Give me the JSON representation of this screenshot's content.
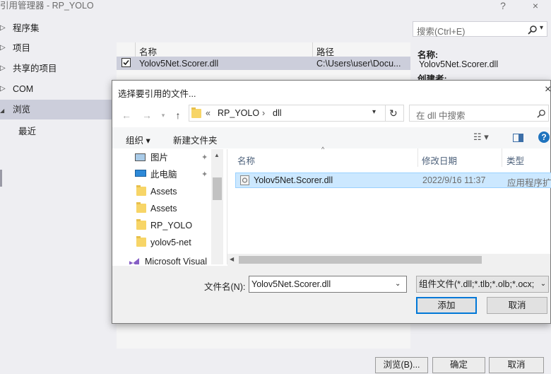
{
  "ref_manager": {
    "title": "引用管理器 - RP_YOLO",
    "help_btn": "?",
    "close_btn": "×",
    "search_placeholder": "搜索(Ctrl+E)",
    "nav": [
      {
        "label": "程序集",
        "arrow": "▷"
      },
      {
        "label": "项目",
        "arrow": "▷"
      },
      {
        "label": "共享的项目",
        "arrow": "▷"
      },
      {
        "label": "COM",
        "arrow": "▷"
      },
      {
        "label": "浏览",
        "arrow": "◢"
      },
      {
        "label": "最近",
        "arrow": ""
      }
    ],
    "columns": [
      "名称",
      "路径"
    ],
    "row": {
      "name": "Yolov5Net.Scorer.dll",
      "path": "C:\\Users\\user\\Docu...",
      "checked": true
    },
    "details": {
      "name_label": "名称:",
      "name_value": "Yolov5Net.Scorer.dll",
      "creator_label": "创建者:"
    },
    "buttons": {
      "browse": "浏览(B)...",
      "ok": "确定",
      "cancel": "取消"
    }
  },
  "file_dialog": {
    "title": "选择要引用的文件...",
    "close_btn": "×",
    "breadcrumb": [
      "«",
      "RP_YOLO",
      "›",
      "dll"
    ],
    "search_placeholder": "在 dll 中搜索",
    "toolbar": {
      "organize": "组织 ▾",
      "new_folder": "新建文件夹"
    },
    "tree": [
      {
        "label": "图片",
        "type": "pictures",
        "pinned": true
      },
      {
        "label": "此电脑",
        "type": "pc",
        "pinned": true
      },
      {
        "label": "Assets",
        "type": "folder",
        "pinned": false
      },
      {
        "label": "Assets",
        "type": "folder",
        "pinned": false
      },
      {
        "label": "RP_YOLO",
        "type": "folder",
        "pinned": false
      },
      {
        "label": "yolov5-net",
        "type": "folder",
        "pinned": false
      },
      {
        "label": "Microsoft Visual",
        "type": "vs",
        "pinned": false
      }
    ],
    "columns": [
      "名称",
      "修改日期",
      "类型"
    ],
    "files": [
      {
        "name": "Yolov5Net.Scorer.dll",
        "modified": "2022/9/16 11:37",
        "type": "应用程序扩展"
      }
    ],
    "filename_label": "文件名(N):",
    "filename_value": "Yolov5Net.Scorer.dll",
    "filetype_value": "组件文件(*.dll;*.tlb;*.olb;*.ocx;",
    "buttons": {
      "add": "添加",
      "cancel": "取消"
    }
  }
}
